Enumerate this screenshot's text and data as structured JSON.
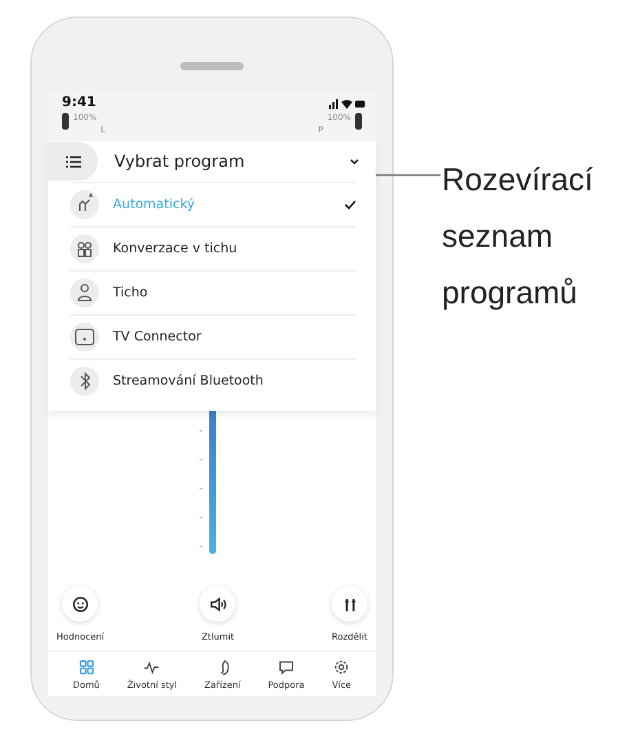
{
  "status_bar": {
    "time": "9:41",
    "left_battery": "100%",
    "left_label": "L",
    "right_label": "P",
    "right_battery": "100%"
  },
  "program_dropdown": {
    "title": "Vybrat program",
    "items": [
      {
        "label": "Automatický",
        "kind": "auto",
        "selected": true
      },
      {
        "label": "Konverzace v tichu",
        "kind": "conversation",
        "selected": false
      },
      {
        "label": "Ticho",
        "kind": "quiet",
        "selected": false
      },
      {
        "label": "TV Connector",
        "kind": "tv",
        "selected": false
      },
      {
        "label": "Streamování Bluetooth",
        "kind": "bluetooth",
        "selected": false
      }
    ]
  },
  "actions": [
    {
      "label": "Hodnocení",
      "kind": "rating"
    },
    {
      "label": "Ztlumit",
      "kind": "mute"
    },
    {
      "label": "Rozdělit",
      "kind": "split"
    }
  ],
  "nav": [
    {
      "label": "Domů",
      "kind": "home",
      "selected": true
    },
    {
      "label": "Životní styl",
      "kind": "lifestyle",
      "selected": false
    },
    {
      "label": "Zařízení",
      "kind": "device",
      "selected": false
    },
    {
      "label": "Podpora",
      "kind": "support",
      "selected": false
    },
    {
      "label": "Více",
      "kind": "more",
      "selected": false
    }
  ],
  "annotation": "Rozevírací seznam programů"
}
